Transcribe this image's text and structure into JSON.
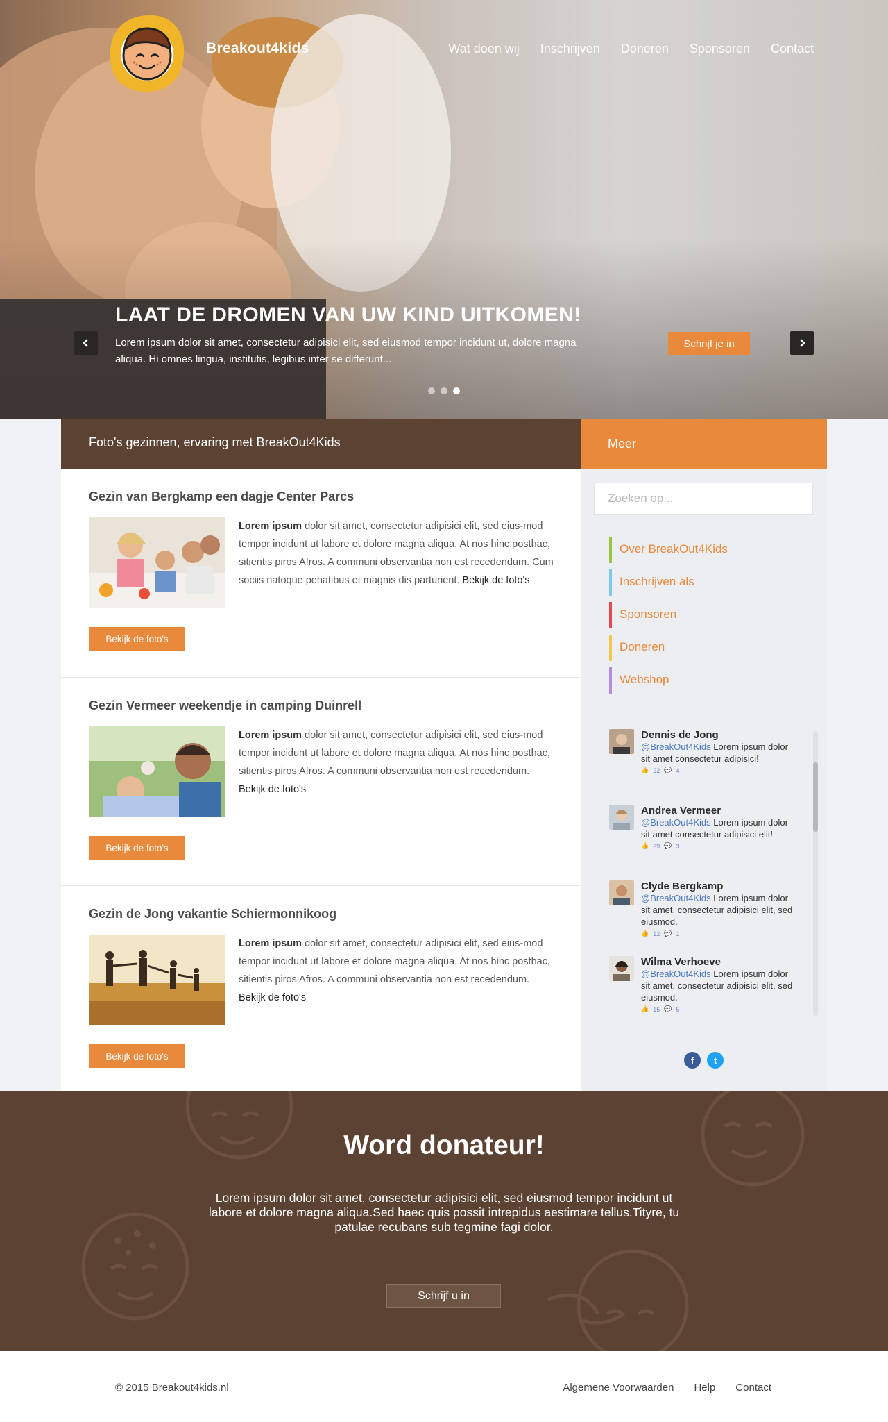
{
  "header": {
    "brand": "Breakout4kids",
    "nav": [
      "Wat doen wij",
      "Inschrijven",
      "Doneren",
      "Sponsoren",
      "Contact"
    ]
  },
  "hero": {
    "title": "LAAT DE DROMEN VAN UW KIND UITKOMEN!",
    "text": "Lorem ipsum dolor sit amet, consectetur adipisici elit, sed eiusmod tempor incidunt ut, dolore magna aliqua. Hi omnes lingua, institutis, legibus inter se differunt...",
    "button": "Schrijf je in",
    "active_slide": 3,
    "slide_count": 3
  },
  "main": {
    "heading": "Foto's gezinnen, ervaring met BreakOut4Kids",
    "posts": [
      {
        "title": "Gezin van Bergkamp een dagje Center Parcs",
        "lead": "Lorem ipsum",
        "text": " dolor sit amet, consectetur adipisici elit, sed eius-mod tempor incidunt ut labore et dolore magna aliqua. At nos hinc posthac, sitientis piros Afros. A communi observantia non est recedendum. Cum sociis natoque penatibus et magnis dis parturient. ",
        "link": "Bekijk de foto's",
        "button": "Bekijk de foto's"
      },
      {
        "title": "Gezin Vermeer weekendje in camping Duinrell",
        "lead": "Lorem ipsum",
        "text": " dolor sit amet, consectetur adipisici elit, sed eius-mod tempor incidunt ut labore et dolore magna aliqua. At nos hinc posthac, sitientis piros Afros. A communi observantia non est recedendum. ",
        "link": "Bekijk de foto's",
        "button": "Bekijk de foto's"
      },
      {
        "title": "Gezin de Jong vakantie Schiermonnikoog",
        "lead": "Lorem ipsum",
        "text": " dolor sit amet, consectetur adipisici elit, sed eius-mod tempor incidunt ut labore et dolore magna aliqua. At nos hinc posthac, sitientis piros Afros. A communi observantia non est recedendum. ",
        "link": "Bekijk de foto's",
        "button": "Bekijk de foto's"
      }
    ]
  },
  "sidebar": {
    "heading": "Meer",
    "search_placeholder": "Zoeken op...",
    "menu": [
      {
        "label": "Over BreakOut4Kids",
        "color": "#9bc53d"
      },
      {
        "label": "Inschrijven als",
        "color": "#7ccbe8"
      },
      {
        "label": "Sponsoren",
        "color": "#e5484d"
      },
      {
        "label": "Doneren",
        "color": "#f2c94c"
      },
      {
        "label": "Webshop",
        "color": "#b98be0"
      }
    ],
    "tweets": [
      {
        "name": "Dennis de Jong",
        "handle": "@BreakOut4Kids",
        "text": " Lorem ipsum dolor sit amet consectetur adipisici!",
        "likes": "22",
        "comments": "4"
      },
      {
        "name": "Andrea Vermeer",
        "handle": "@BreakOut4Kids",
        "text": " Lorem ipsum dolor sit amet consectetur adipisici elit!",
        "likes": "29",
        "comments": "3"
      },
      {
        "name": "Clyde Bergkamp",
        "handle": "@BreakOut4Kids",
        "text": " Lorem ipsum dolor sit amet, consectetur adipisici elit, sed eiusmod.",
        "likes": "12",
        "comments": "1"
      },
      {
        "name": "Wilma Verhoeve",
        "handle": "@BreakOut4Kids",
        "text": " Lorem ipsum dolor sit amet, consectetur adipisici elit, sed eiusmod.",
        "likes": "15",
        "comments": "5"
      }
    ],
    "social": {
      "facebook": "f",
      "twitter": "t"
    }
  },
  "donate": {
    "title": "Word donateur!",
    "text": "Lorem ipsum dolor sit amet, consectetur adipisici elit, sed eiusmod tempor incidunt ut labore et dolore magna aliqua.Sed haec quis possit intrepidus aestimare tellus.Tityre, tu patulae recubans sub tegmine fagi  dolor.",
    "button": "Schrijf u in"
  },
  "footer": {
    "copyright": "© 2015 Breakout4kids.nl",
    "links": [
      "Algemene Voorwaarden",
      "Help",
      "Contact"
    ]
  },
  "colors": {
    "accent": "#e8893c",
    "brown": "#5c4232",
    "sidebar_bg": "#eceef2",
    "page_bg": "#f1f2f6"
  }
}
